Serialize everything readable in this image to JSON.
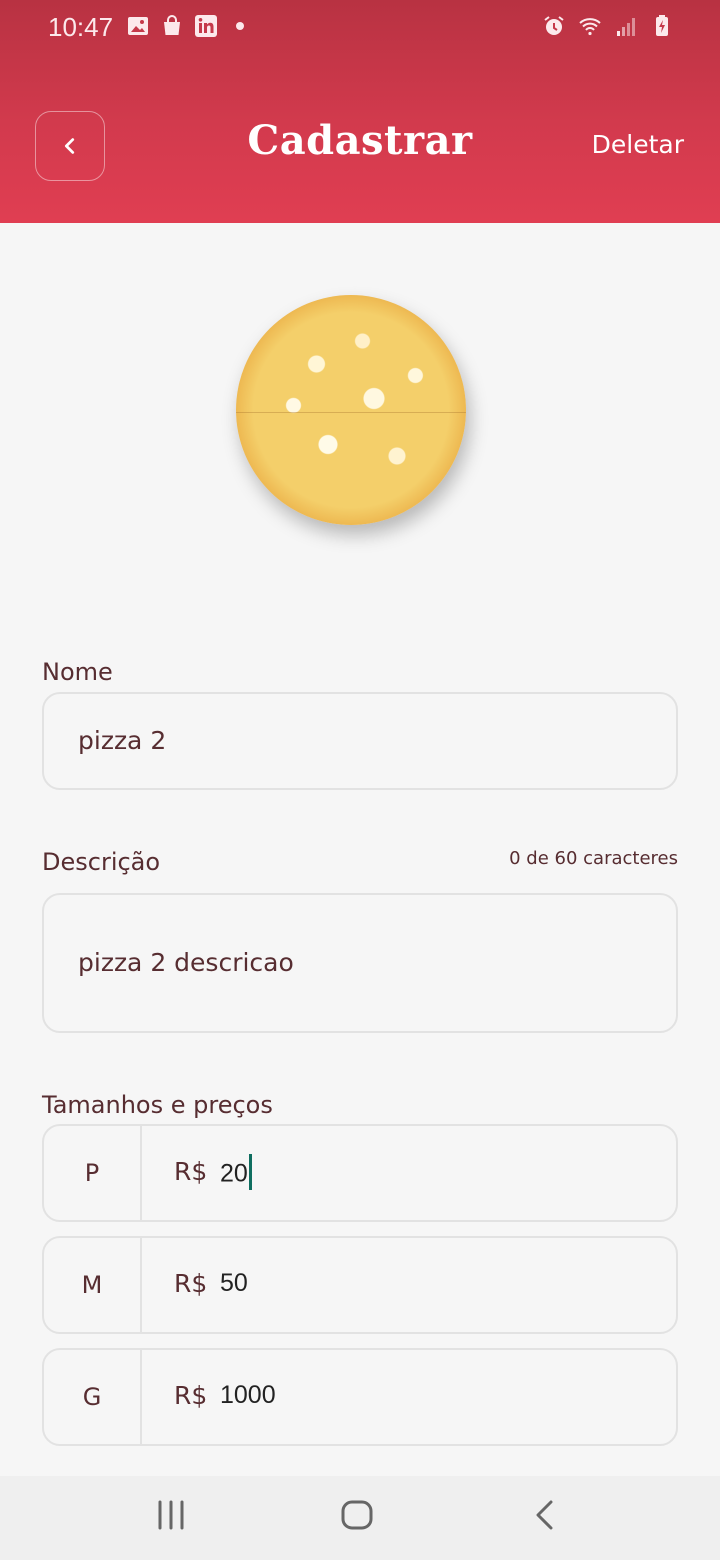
{
  "status_bar": {
    "time": "10:47",
    "left_icons": [
      "image-icon",
      "shopping-bag-icon",
      "linkedin-icon",
      "dot-icon"
    ],
    "right_icons": [
      "alarm-icon",
      "wifi-icon",
      "signal-icon",
      "battery-charging-icon"
    ]
  },
  "header": {
    "title": "Cadastrar",
    "back_icon": "chevron-left-icon",
    "delete_label": "Deletar"
  },
  "product_image": "pizza-image",
  "form": {
    "name": {
      "label": "Nome",
      "value": "pizza 2"
    },
    "description": {
      "label": "Descrição",
      "counter": "0 de 60 caracteres",
      "value": "pizza 2 descricao"
    },
    "sizes": {
      "label": "Tamanhos e preços",
      "currency": "R$",
      "items": [
        {
          "size": "P",
          "price": "20"
        },
        {
          "size": "M",
          "price": "50"
        },
        {
          "size": "G",
          "price": "1000"
        }
      ]
    }
  },
  "colors": {
    "header_top": "#b83242",
    "header_bottom": "#e03e52",
    "text": "#572d31",
    "caret": "#0f6e60"
  },
  "nav": [
    "recent-apps-icon",
    "home-icon",
    "back-icon"
  ]
}
